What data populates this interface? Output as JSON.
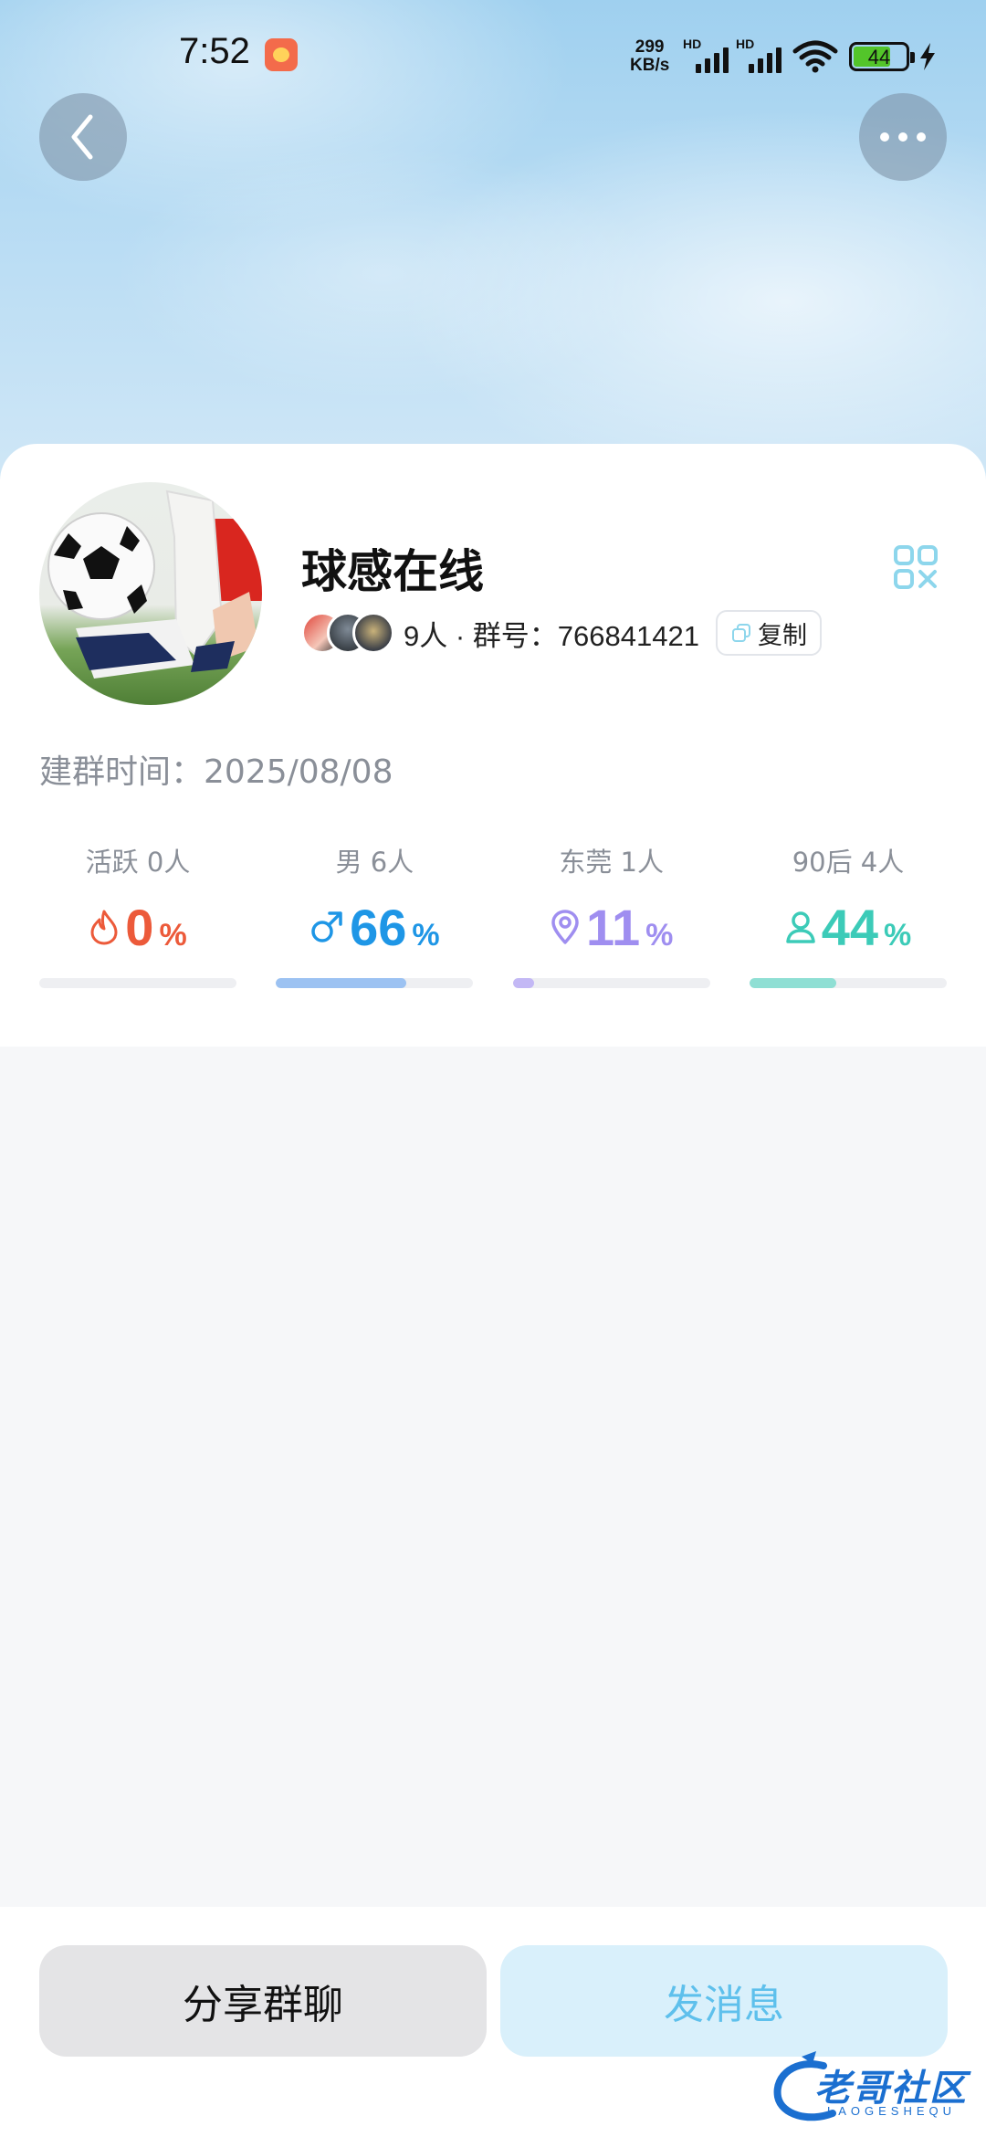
{
  "status_bar": {
    "time": "7:52",
    "net_speed_value": "299",
    "net_speed_unit": "KB/s",
    "signal_1_label": "HD",
    "signal_2_label": "HD",
    "battery": "44"
  },
  "nav": {
    "back_icon": "chevron-left-icon",
    "more_icon": "more-dots-icon"
  },
  "group": {
    "name": "球感在线",
    "member_info": "9人 · 群号：766841421",
    "copy_label": "复制",
    "created": "建群时间：2025/08/08"
  },
  "stats": [
    {
      "label": "活跃 0人",
      "value": "0",
      "unit": "%",
      "percent": 0,
      "color": "#ec5a3a",
      "icon": "flame-icon"
    },
    {
      "label": "男 6人",
      "value": "66",
      "unit": "%",
      "percent": 66,
      "color": "#1e96e6",
      "icon": "male-icon",
      "bar_color": "#9cc2f2"
    },
    {
      "label": "东莞 1人",
      "value": "11",
      "unit": "%",
      "percent": 11,
      "color": "#9f8ef0",
      "icon": "location-pin-icon",
      "bar_color": "#c3b8f5"
    },
    {
      "label": "90后 4人",
      "value": "44",
      "unit": "%",
      "percent": 44,
      "color": "#3ccbb8",
      "icon": "person-icon",
      "bar_color": "#8fdfd4"
    }
  ],
  "actions": {
    "share_label": "分享群聊",
    "send_label": "发消息"
  },
  "watermark": {
    "text": "老哥社区",
    "sub": "LAOGESHEQU"
  }
}
